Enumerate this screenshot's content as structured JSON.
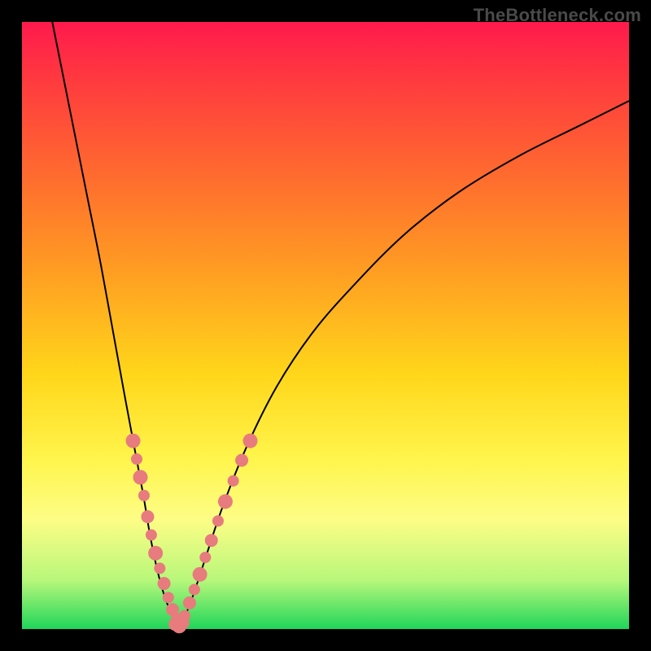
{
  "watermark": "TheBottleneck.com",
  "colors": {
    "frame": "#000000",
    "gradient_top": "#ff1a4d",
    "gradient_upper": "#ff6a2f",
    "gradient_mid": "#ffd61a",
    "gradient_lower": "#fdfd86",
    "gradient_bottom": "#1fd65a",
    "curve": "#000000",
    "bead": "#e77b7e"
  },
  "chart_data": {
    "type": "line",
    "title": "",
    "xlabel": "",
    "ylabel": "",
    "xlim": [
      0,
      100
    ],
    "ylim": [
      0,
      100
    ],
    "grid": false,
    "legend": false,
    "series": [
      {
        "name": "left-curve",
        "x": [
          5,
          7,
          9,
          11,
          13,
          15,
          17,
          18.5,
          20,
          21,
          22,
          23,
          24,
          25,
          26
        ],
        "y": [
          100,
          90,
          80,
          70,
          60,
          49,
          38,
          30,
          22,
          16,
          11,
          7,
          4,
          2,
          0
        ]
      },
      {
        "name": "right-curve",
        "x": [
          26,
          28,
          30,
          33,
          37,
          42,
          48,
          55,
          63,
          72,
          82,
          92,
          100
        ],
        "y": [
          0,
          5,
          11,
          20,
          30,
          40,
          49,
          57,
          65,
          72,
          78,
          83,
          87
        ]
      }
    ],
    "beads_left": {
      "name": "left-beads",
      "comment": "salmon dots clustered on lower left curve",
      "x": [
        18.3,
        18.9,
        19.5,
        20.1,
        20.7,
        21.3,
        22.0,
        22.7,
        23.4,
        24.1,
        24.8,
        25.5
      ],
      "y": [
        31,
        28,
        25,
        22,
        18.5,
        15.5,
        12.5,
        10,
        7.5,
        5.2,
        3.2,
        1.7
      ],
      "r": [
        9,
        7,
        9,
        7,
        8,
        7,
        9,
        7,
        8,
        7,
        8,
        7
      ]
    },
    "beads_right": {
      "name": "right-beads",
      "comment": "salmon dots clustered on lower right curve",
      "x": [
        26.8,
        27.6,
        28.4,
        29.3,
        30.2,
        31.2,
        32.3,
        33.5,
        34.8,
        36.2,
        37.6
      ],
      "y": [
        2.2,
        4.3,
        6.5,
        9,
        11.8,
        14.6,
        17.8,
        21,
        24.4,
        27.8,
        31
      ],
      "r": [
        7,
        8,
        7,
        9,
        7,
        8,
        7,
        9,
        7,
        8,
        9
      ]
    },
    "beads_bottom": {
      "name": "bottom-beads",
      "comment": "short run along the valley floor",
      "x": [
        25.2,
        25.9,
        26.5
      ],
      "y": [
        0.8,
        0.5,
        1.0
      ],
      "r": [
        8,
        9,
        8
      ]
    }
  }
}
